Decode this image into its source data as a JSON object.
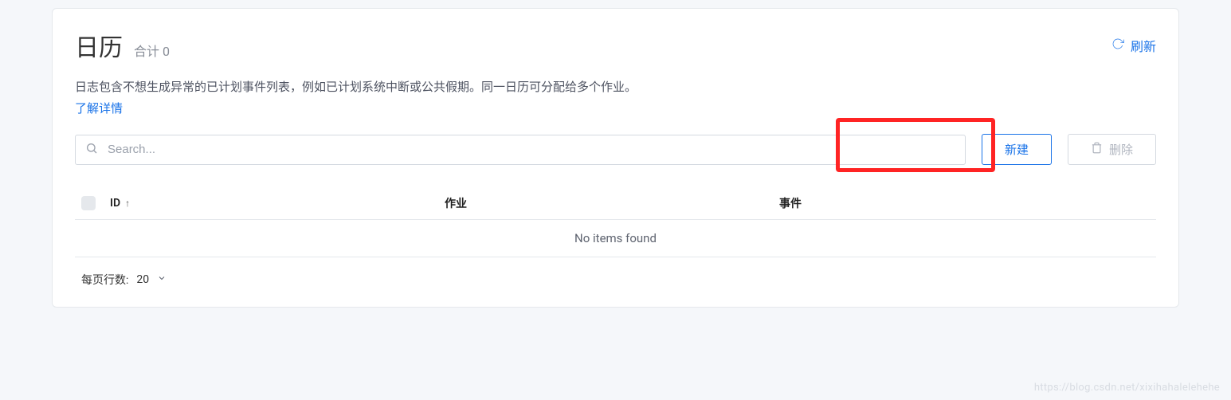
{
  "header": {
    "title": "日历",
    "subtitle_label": "合计",
    "count": "0",
    "refresh_label": "刷新"
  },
  "description": "日志包含不想生成异常的已计划事件列表，例如已计划系统中断或公共假期。同一日历可分配给多个作业。",
  "learn_more": "了解详情",
  "search": {
    "placeholder": "Search..."
  },
  "buttons": {
    "create": "新建",
    "delete": "删除"
  },
  "table": {
    "columns": {
      "id": "ID",
      "job": "作业",
      "event": "事件"
    },
    "empty": "No items found"
  },
  "pagination": {
    "rows_label": "每页行数:",
    "rows_value": "20"
  },
  "watermark": "https://blog.csdn.net/xixihahalelehehe"
}
